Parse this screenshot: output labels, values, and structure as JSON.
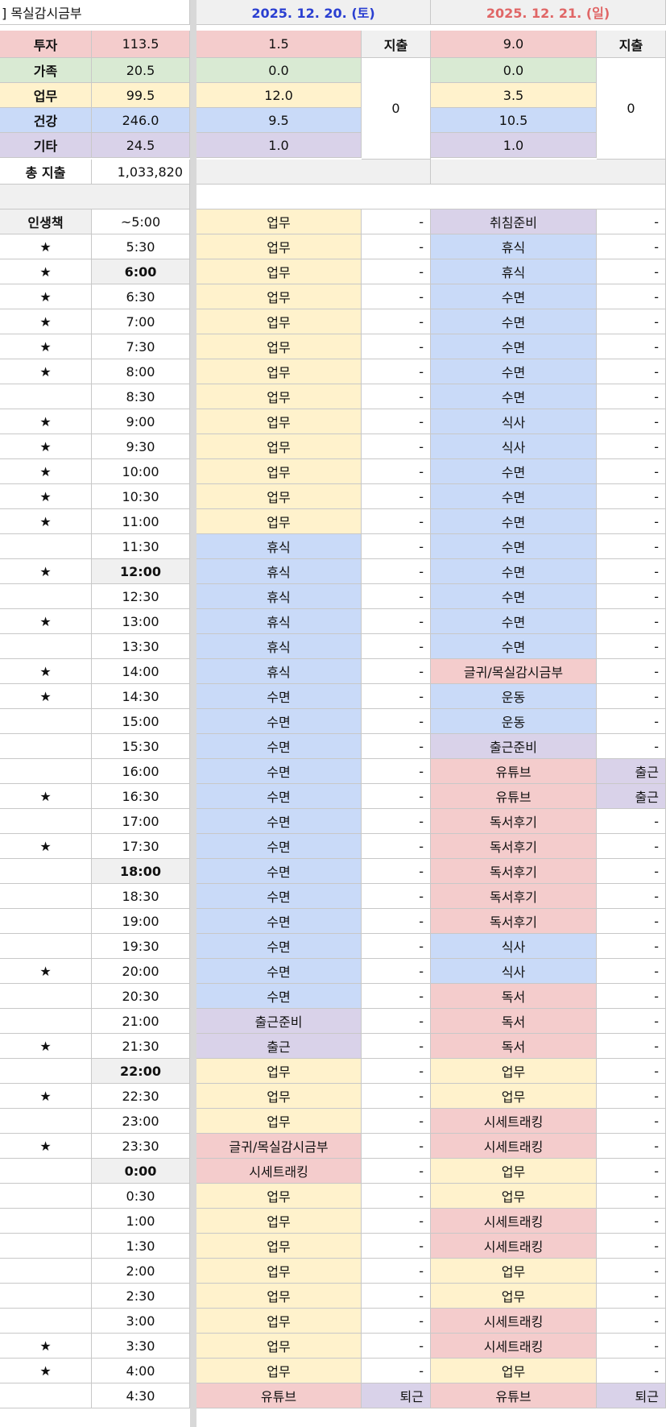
{
  "sheet": {
    "title": "] 목실감시금부",
    "date1": "2025. 12. 20. (토)",
    "date2": "2025. 12. 21. (일)",
    "spend_label": "지출",
    "spend_day1": "0",
    "spend_day2": "0",
    "total_label": "총 지출",
    "total_value": "1,033,820"
  },
  "categories": [
    {
      "label": "투자",
      "total": "113.5",
      "day1": "1.5",
      "day2": "9.0",
      "color": "inv"
    },
    {
      "label": "가족",
      "total": "20.5",
      "day1": "0.0",
      "day2": "0.0",
      "color": "fam"
    },
    {
      "label": "업무",
      "total": "99.5",
      "day1": "12.0",
      "day2": "3.5",
      "color": "wrk"
    },
    {
      "label": "건강",
      "total": "246.0",
      "day1": "9.5",
      "day2": "10.5",
      "color": "hlt"
    },
    {
      "label": "기타",
      "total": "24.5",
      "day1": "1.0",
      "day2": "1.0",
      "color": "etc"
    }
  ],
  "schedule_header": "인생책",
  "schedule": [
    {
      "mark": "",
      "time": "~5:00",
      "bold": false,
      "a1": "업무",
      "c1": "wrk",
      "b1": "-",
      "a2": "취침준비",
      "c2": "etc",
      "b2": "-"
    },
    {
      "mark": "★",
      "time": "5:30",
      "bold": false,
      "a1": "업무",
      "c1": "wrk",
      "b1": "-",
      "a2": "휴식",
      "c2": "hlt",
      "b2": "-"
    },
    {
      "mark": "★",
      "time": "6:00",
      "bold": true,
      "a1": "업무",
      "c1": "wrk",
      "b1": "-",
      "a2": "휴식",
      "c2": "hlt",
      "b2": "-"
    },
    {
      "mark": "★",
      "time": "6:30",
      "bold": false,
      "a1": "업무",
      "c1": "wrk",
      "b1": "-",
      "a2": "수면",
      "c2": "hlt",
      "b2": "-"
    },
    {
      "mark": "★",
      "time": "7:00",
      "bold": false,
      "a1": "업무",
      "c1": "wrk",
      "b1": "-",
      "a2": "수면",
      "c2": "hlt",
      "b2": "-"
    },
    {
      "mark": "★",
      "time": "7:30",
      "bold": false,
      "a1": "업무",
      "c1": "wrk",
      "b1": "-",
      "a2": "수면",
      "c2": "hlt",
      "b2": "-"
    },
    {
      "mark": "★",
      "time": "8:00",
      "bold": false,
      "a1": "업무",
      "c1": "wrk",
      "b1": "-",
      "a2": "수면",
      "c2": "hlt",
      "b2": "-"
    },
    {
      "mark": "",
      "time": "8:30",
      "bold": false,
      "a1": "업무",
      "c1": "wrk",
      "b1": "-",
      "a2": "수면",
      "c2": "hlt",
      "b2": "-"
    },
    {
      "mark": "★",
      "time": "9:00",
      "bold": false,
      "a1": "업무",
      "c1": "wrk",
      "b1": "-",
      "a2": "식사",
      "c2": "hlt",
      "b2": "-"
    },
    {
      "mark": "★",
      "time": "9:30",
      "bold": false,
      "a1": "업무",
      "c1": "wrk",
      "b1": "-",
      "a2": "식사",
      "c2": "hlt",
      "b2": "-"
    },
    {
      "mark": "★",
      "time": "10:00",
      "bold": false,
      "a1": "업무",
      "c1": "wrk",
      "b1": "-",
      "a2": "수면",
      "c2": "hlt",
      "b2": "-"
    },
    {
      "mark": "★",
      "time": "10:30",
      "bold": false,
      "a1": "업무",
      "c1": "wrk",
      "b1": "-",
      "a2": "수면",
      "c2": "hlt",
      "b2": "-"
    },
    {
      "mark": "★",
      "time": "11:00",
      "bold": false,
      "a1": "업무",
      "c1": "wrk",
      "b1": "-",
      "a2": "수면",
      "c2": "hlt",
      "b2": "-"
    },
    {
      "mark": "",
      "time": "11:30",
      "bold": false,
      "a1": "휴식",
      "c1": "hlt",
      "b1": "-",
      "a2": "수면",
      "c2": "hlt",
      "b2": "-"
    },
    {
      "mark": "★",
      "time": "12:00",
      "bold": true,
      "a1": "휴식",
      "c1": "hlt",
      "b1": "-",
      "a2": "수면",
      "c2": "hlt",
      "b2": "-"
    },
    {
      "mark": "",
      "time": "12:30",
      "bold": false,
      "a1": "휴식",
      "c1": "hlt",
      "b1": "-",
      "a2": "수면",
      "c2": "hlt",
      "b2": "-"
    },
    {
      "mark": "★",
      "time": "13:00",
      "bold": false,
      "a1": "휴식",
      "c1": "hlt",
      "b1": "-",
      "a2": "수면",
      "c2": "hlt",
      "b2": "-"
    },
    {
      "mark": "",
      "time": "13:30",
      "bold": false,
      "a1": "휴식",
      "c1": "hlt",
      "b1": "-",
      "a2": "수면",
      "c2": "hlt",
      "b2": "-"
    },
    {
      "mark": "★",
      "time": "14:00",
      "bold": false,
      "a1": "휴식",
      "c1": "hlt",
      "b1": "-",
      "a2": "글귀/목실감시금부",
      "c2": "inv",
      "b2": "-"
    },
    {
      "mark": "★",
      "time": "14:30",
      "bold": false,
      "a1": "수면",
      "c1": "hlt",
      "b1": "-",
      "a2": "운동",
      "c2": "hlt",
      "b2": "-"
    },
    {
      "mark": "",
      "time": "15:00",
      "bold": false,
      "a1": "수면",
      "c1": "hlt",
      "b1": "-",
      "a2": "운동",
      "c2": "hlt",
      "b2": "-"
    },
    {
      "mark": "",
      "time": "15:30",
      "bold": false,
      "a1": "수면",
      "c1": "hlt",
      "b1": "-",
      "a2": "출근준비",
      "c2": "etc",
      "b2": "-"
    },
    {
      "mark": "",
      "time": "16:00",
      "bold": false,
      "a1": "수면",
      "c1": "hlt",
      "b1": "-",
      "a2": "유튜브",
      "c2": "inv",
      "b2": "출근",
      "b2c": "etc"
    },
    {
      "mark": "★",
      "time": "16:30",
      "bold": false,
      "a1": "수면",
      "c1": "hlt",
      "b1": "-",
      "a2": "유튜브",
      "c2": "inv",
      "b2": "출근",
      "b2c": "etc"
    },
    {
      "mark": "",
      "time": "17:00",
      "bold": false,
      "a1": "수면",
      "c1": "hlt",
      "b1": "-",
      "a2": "독서후기",
      "c2": "inv",
      "b2": "-"
    },
    {
      "mark": "★",
      "time": "17:30",
      "bold": false,
      "a1": "수면",
      "c1": "hlt",
      "b1": "-",
      "a2": "독서후기",
      "c2": "inv",
      "b2": "-"
    },
    {
      "mark": "",
      "time": "18:00",
      "bold": true,
      "a1": "수면",
      "c1": "hlt",
      "b1": "-",
      "a2": "독서후기",
      "c2": "inv",
      "b2": "-"
    },
    {
      "mark": "",
      "time": "18:30",
      "bold": false,
      "a1": "수면",
      "c1": "hlt",
      "b1": "-",
      "a2": "독서후기",
      "c2": "inv",
      "b2": "-"
    },
    {
      "mark": "",
      "time": "19:00",
      "bold": false,
      "a1": "수면",
      "c1": "hlt",
      "b1": "-",
      "a2": "독서후기",
      "c2": "inv",
      "b2": "-"
    },
    {
      "mark": "",
      "time": "19:30",
      "bold": false,
      "a1": "수면",
      "c1": "hlt",
      "b1": "-",
      "a2": "식사",
      "c2": "hlt",
      "b2": "-"
    },
    {
      "mark": "★",
      "time": "20:00",
      "bold": false,
      "a1": "수면",
      "c1": "hlt",
      "b1": "-",
      "a2": "식사",
      "c2": "hlt",
      "b2": "-"
    },
    {
      "mark": "",
      "time": "20:30",
      "bold": false,
      "a1": "수면",
      "c1": "hlt",
      "b1": "-",
      "a2": "독서",
      "c2": "inv",
      "b2": "-"
    },
    {
      "mark": "",
      "time": "21:00",
      "bold": false,
      "a1": "출근준비",
      "c1": "etc",
      "b1": "-",
      "a2": "독서",
      "c2": "inv",
      "b2": "-"
    },
    {
      "mark": "★",
      "time": "21:30",
      "bold": false,
      "a1": "출근",
      "c1": "etc",
      "b1": "-",
      "a2": "독서",
      "c2": "inv",
      "b2": "-"
    },
    {
      "mark": "",
      "time": "22:00",
      "bold": true,
      "a1": "업무",
      "c1": "wrk",
      "b1": "-",
      "a2": "업무",
      "c2": "wrk",
      "b2": "-"
    },
    {
      "mark": "★",
      "time": "22:30",
      "bold": false,
      "a1": "업무",
      "c1": "wrk",
      "b1": "-",
      "a2": "업무",
      "c2": "wrk",
      "b2": "-"
    },
    {
      "mark": "",
      "time": "23:00",
      "bold": false,
      "a1": "업무",
      "c1": "wrk",
      "b1": "-",
      "a2": "시세트래킹",
      "c2": "inv",
      "b2": "-"
    },
    {
      "mark": "★",
      "time": "23:30",
      "bold": false,
      "a1": "글귀/목실감시금부",
      "c1": "inv",
      "b1": "-",
      "a2": "시세트래킹",
      "c2": "inv",
      "b2": "-"
    },
    {
      "mark": "",
      "time": "0:00",
      "bold": true,
      "a1": "시세트래킹",
      "c1": "inv",
      "b1": "-",
      "a2": "업무",
      "c2": "wrk",
      "b2": "-"
    },
    {
      "mark": "",
      "time": "0:30",
      "bold": false,
      "a1": "업무",
      "c1": "wrk",
      "b1": "-",
      "a2": "업무",
      "c2": "wrk",
      "b2": "-"
    },
    {
      "mark": "",
      "time": "1:00",
      "bold": false,
      "a1": "업무",
      "c1": "wrk",
      "b1": "-",
      "a2": "시세트래킹",
      "c2": "inv",
      "b2": "-"
    },
    {
      "mark": "",
      "time": "1:30",
      "bold": false,
      "a1": "업무",
      "c1": "wrk",
      "b1": "-",
      "a2": "시세트래킹",
      "c2": "inv",
      "b2": "-"
    },
    {
      "mark": "",
      "time": "2:00",
      "bold": false,
      "a1": "업무",
      "c1": "wrk",
      "b1": "-",
      "a2": "업무",
      "c2": "wrk",
      "b2": "-"
    },
    {
      "mark": "",
      "time": "2:30",
      "bold": false,
      "a1": "업무",
      "c1": "wrk",
      "b1": "-",
      "a2": "업무",
      "c2": "wrk",
      "b2": "-"
    },
    {
      "mark": "",
      "time": "3:00",
      "bold": false,
      "a1": "업무",
      "c1": "wrk",
      "b1": "-",
      "a2": "시세트래킹",
      "c2": "inv",
      "b2": "-"
    },
    {
      "mark": "★",
      "time": "3:30",
      "bold": false,
      "a1": "업무",
      "c1": "wrk",
      "b1": "-",
      "a2": "시세트래킹",
      "c2": "inv",
      "b2": "-"
    },
    {
      "mark": "★",
      "time": "4:00",
      "bold": false,
      "a1": "업무",
      "c1": "wrk",
      "b1": "-",
      "a2": "업무",
      "c2": "wrk",
      "b2": "-"
    },
    {
      "mark": "",
      "time": "4:30",
      "bold": false,
      "a1": "유튜브",
      "c1": "inv",
      "b1": "퇴근",
      "b1c": "etc",
      "a2": "유튜브",
      "c2": "inv",
      "b2": "퇴근",
      "b2c": "etc"
    }
  ]
}
